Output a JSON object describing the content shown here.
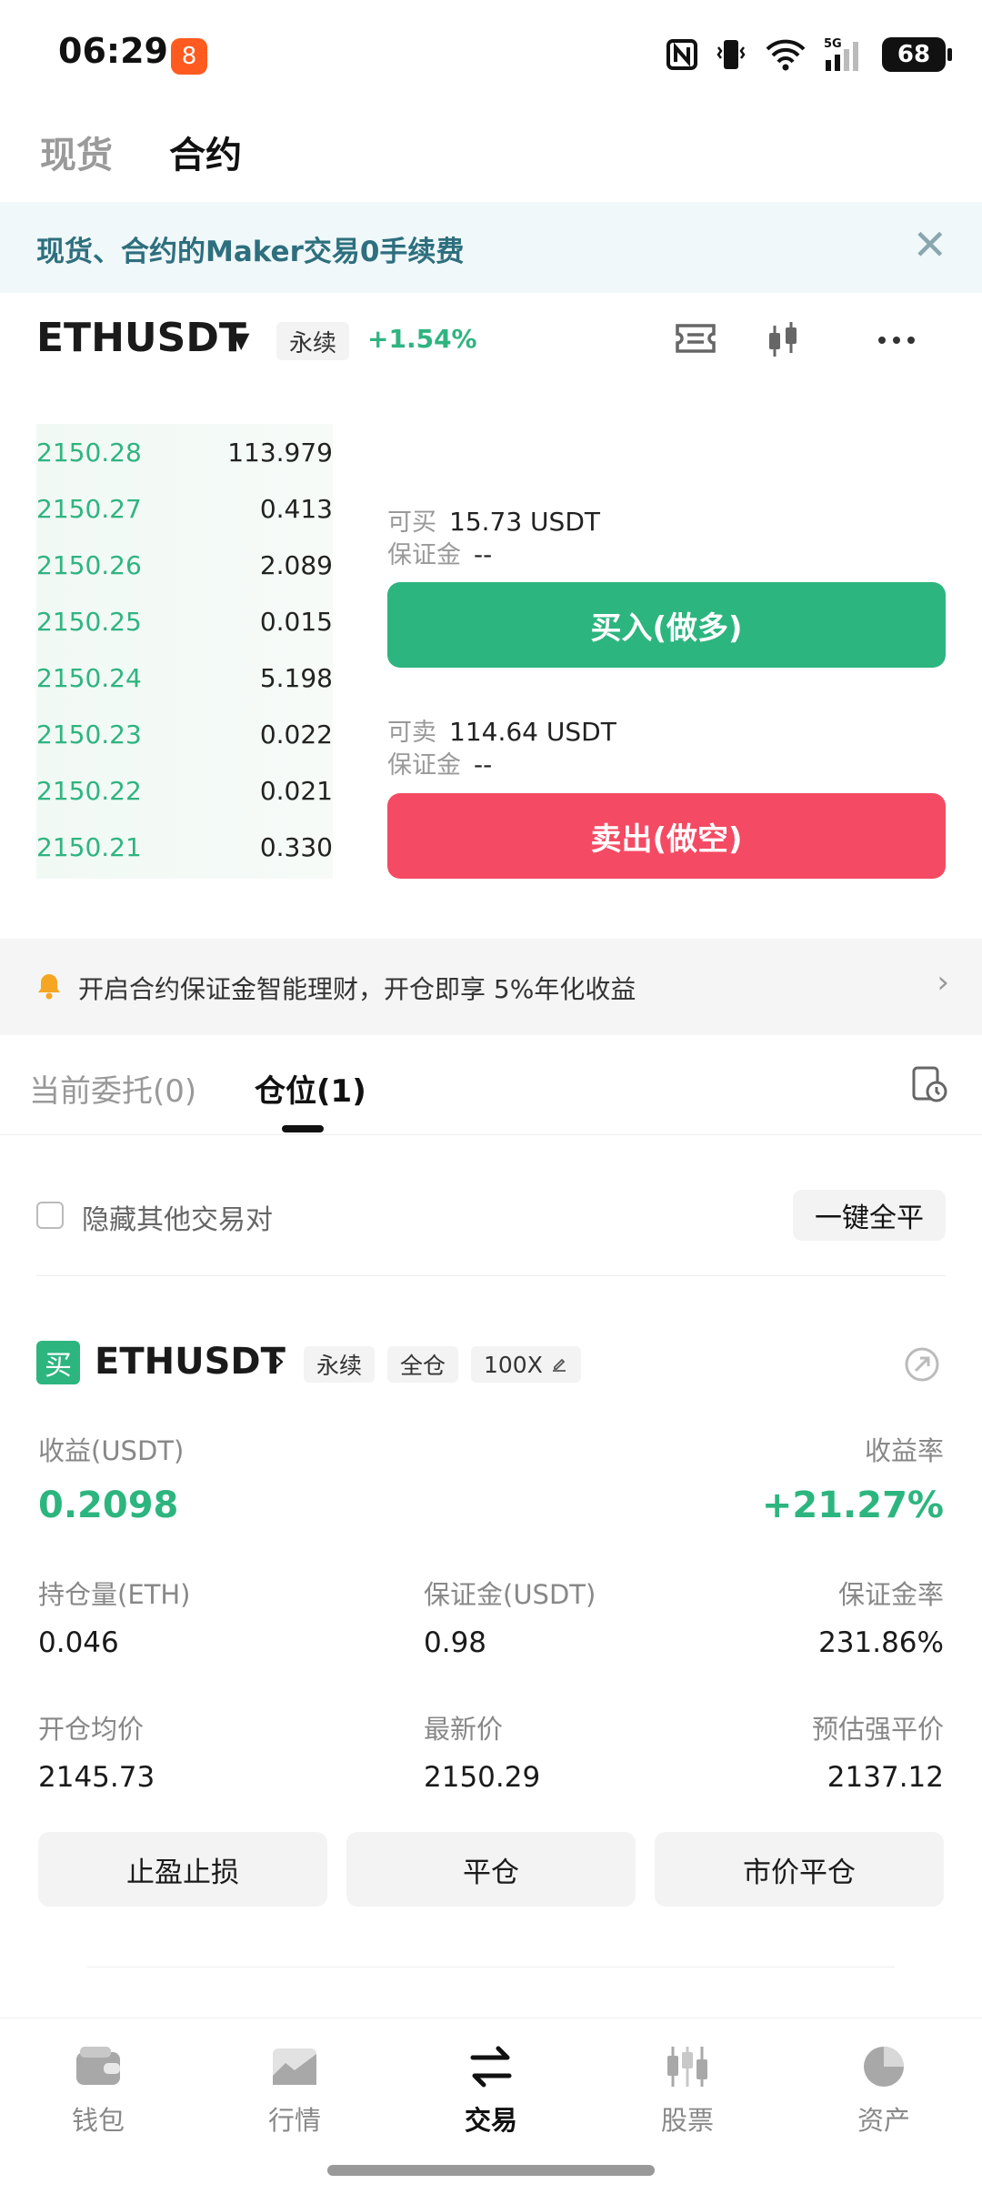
{
  "status_bar": {
    "time": "06:29",
    "app_badge": "8",
    "network": "5G",
    "wifi_badge": "5",
    "battery": "68"
  },
  "top_tabs": [
    {
      "label": "现货",
      "active": false
    },
    {
      "label": "合约",
      "active": true
    }
  ],
  "promo": {
    "text": "现货、合约的Maker交易0手续费"
  },
  "pair": {
    "name": "ETHUSDT",
    "tag": "永续",
    "change": "+1.54%"
  },
  "order_book": [
    {
      "price": "2150.28",
      "qty": "113.979"
    },
    {
      "price": "2150.27",
      "qty": "0.413"
    },
    {
      "price": "2150.26",
      "qty": "2.089"
    },
    {
      "price": "2150.25",
      "qty": "0.015"
    },
    {
      "price": "2150.24",
      "qty": "5.198"
    },
    {
      "price": "2150.23",
      "qty": "0.022"
    },
    {
      "price": "2150.22",
      "qty": "0.021"
    },
    {
      "price": "2150.21",
      "qty": "0.330"
    }
  ],
  "buy_panel": {
    "avail_label": "可买",
    "avail_value": "15.73 USDT",
    "margin_label": "保证金",
    "margin_value": "--",
    "button": "买入(做多)"
  },
  "sell_panel": {
    "avail_label": "可卖",
    "avail_value": "114.64 USDT",
    "margin_label": "保证金",
    "margin_value": "--",
    "button": "卖出(做空)"
  },
  "notice": {
    "text": "开启合约保证金智能理财，开仓即享 5%年化收益"
  },
  "order_tabs": [
    {
      "label": "当前委托(0)",
      "active": false
    },
    {
      "label": "仓位(1)",
      "active": true
    }
  ],
  "filters": {
    "hide_label": "隐藏其他交易对",
    "close_all": "一键全平"
  },
  "position": {
    "side": "买",
    "pair": "ETHUSDT",
    "tags": [
      "永续",
      "全仓",
      "100X"
    ],
    "pnl_label": "收益(USDT)",
    "pnl_value": "0.2098",
    "roe_label": "收益率",
    "roe_value": "+21.27%",
    "size_label": "持仓量(ETH)",
    "size_value": "0.046",
    "margin_label": "保证金(USDT)",
    "margin_value": "0.98",
    "margin_ratio_label": "保证金率",
    "margin_ratio_value": "231.86%",
    "entry_label": "开仓均价",
    "entry_value": "2145.73",
    "mark_label": "最新价",
    "mark_value": "2150.29",
    "liq_label": "预估强平价",
    "liq_value": "2137.12",
    "actions": [
      "止盈止损",
      "平仓",
      "市价平仓"
    ]
  },
  "bottom_nav": [
    {
      "label": "钱包",
      "icon": "wallet-icon",
      "active": false
    },
    {
      "label": "行情",
      "icon": "market-chart-icon",
      "active": false
    },
    {
      "label": "交易",
      "icon": "swap-arrows-icon",
      "active": true
    },
    {
      "label": "股票",
      "icon": "stock-candles-icon",
      "active": false
    },
    {
      "label": "资产",
      "icon": "pie-chart-icon",
      "active": false
    }
  ],
  "colors": {
    "green": "#2db57f",
    "red": "#f54a63",
    "promo_text": "#2e6f7e"
  }
}
